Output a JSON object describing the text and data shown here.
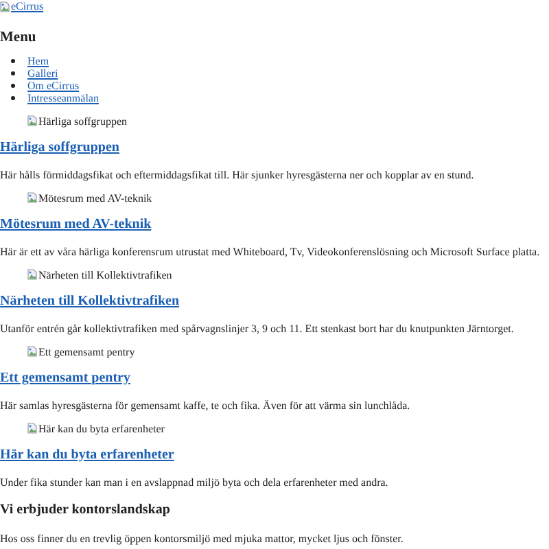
{
  "logo": {
    "alt": "eCirrus"
  },
  "menu": {
    "title": "Menu",
    "items": [
      "Hem",
      "Galleri",
      "Om eCirrus",
      "Intresseanmälan"
    ]
  },
  "sections": [
    {
      "kind": "linked",
      "image_alt": "Härliga soffgruppen",
      "heading": "Härliga soffgruppen",
      "text": "Här hålls förmiddagsfikat och eftermiddagsfikat till. Här sjunker hyresgästerna ner och kopplar av en stund."
    },
    {
      "kind": "linked",
      "image_alt": "Mötesrum med AV-teknik",
      "heading": "Mötesrum med AV-teknik",
      "text": "Här är ett av våra härliga konferensrum utrustat med Whiteboard, Tv, Videokonferenslösning och Microsoft Surface platta."
    },
    {
      "kind": "linked",
      "image_alt": "Närheten till Kollektivtrafiken",
      "heading": "Närheten till Kollektivtrafiken",
      "text": "Utanför entrén går kollektivtrafiken med spårvagnslinjer 3, 9 och 11. Ett stenkast bort har du knutpunkten Järntorget."
    },
    {
      "kind": "linked",
      "image_alt": "Ett gemensamt pentry",
      "heading": "Ett gemensamt pentry",
      "text": "Här samlas hyresgästerna för gemensamt kaffe, te och fika. Även för att värma sin lunchlåda."
    },
    {
      "kind": "linked",
      "image_alt": "Här kan du byta erfarenheter",
      "heading": "Här kan du byta erfarenheter",
      "text": "Under fika stunder kan man i en avslappnad miljö byta och dela erfarenheter med andra."
    },
    {
      "kind": "plain",
      "heading": "Vi erbjuder kontorslandskap",
      "text": "Hos oss finner du en trevlig öppen kontorsmiljö med mjuka mattor, mycket ljus och fönster."
    }
  ]
}
